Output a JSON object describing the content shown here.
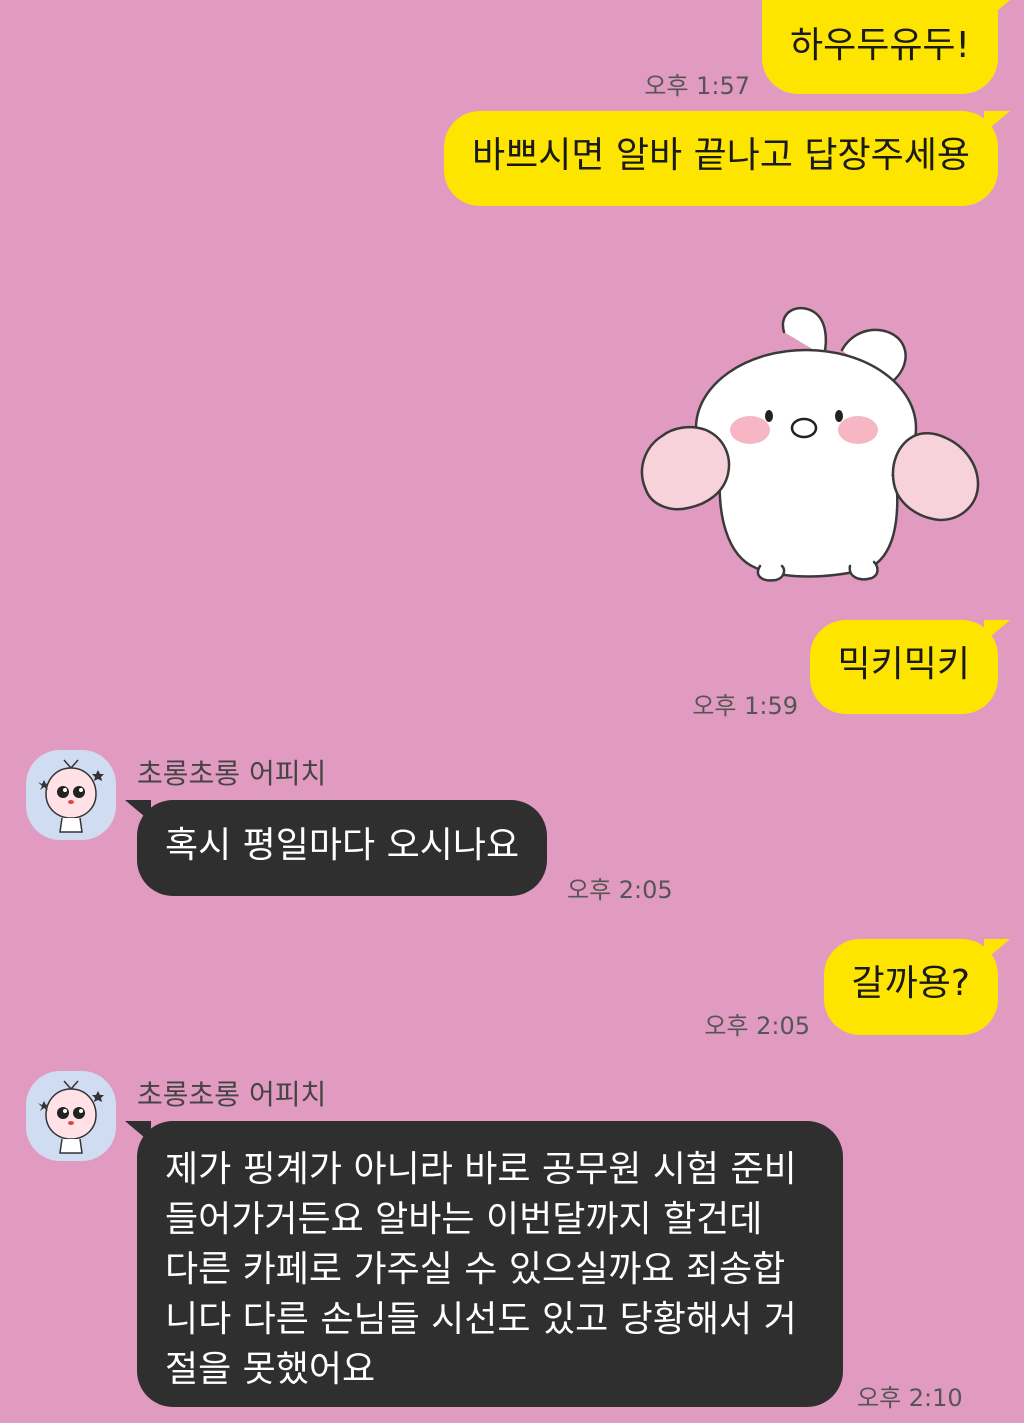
{
  "messages": [
    {
      "type": "outgoing",
      "text": "하우두유두!",
      "time": ""
    },
    {
      "type": "outgoing",
      "text": "바쁘시면 알바 끝나고 답장주세용",
      "time": "오후 1:57"
    },
    {
      "type": "sticker",
      "name": "bunny-sticker"
    },
    {
      "type": "outgoing",
      "text": "믹키믹키",
      "time": "오후 1:59"
    },
    {
      "type": "incoming",
      "sender": "초롱초롱 어피치",
      "text": "혹시 평일마다 오시나요",
      "time": "오후 2:05"
    },
    {
      "type": "outgoing",
      "text": "갈까용?",
      "time": "오후 2:05"
    },
    {
      "type": "incoming",
      "sender": "초롱초롱 어피치",
      "lines": [
        "제가 핑계가 아니라 바로 공무원 시험 준비",
        "들어가거든요 알바는 이번달까지 할건데",
        "다른 카페로 가주실 수 있으실까요 죄송합",
        "니다 다른 손님들 시선도 있고 당황해서 거",
        "절을 못했어요"
      ],
      "time": "오후 2:10"
    }
  ],
  "colors": {
    "background": "#e29bc0",
    "outgoing_bubble": "#fee500",
    "incoming_bubble": "#2f2f2f"
  },
  "icons": [
    "apeach-avatar-icon",
    "bunny-sticker"
  ]
}
